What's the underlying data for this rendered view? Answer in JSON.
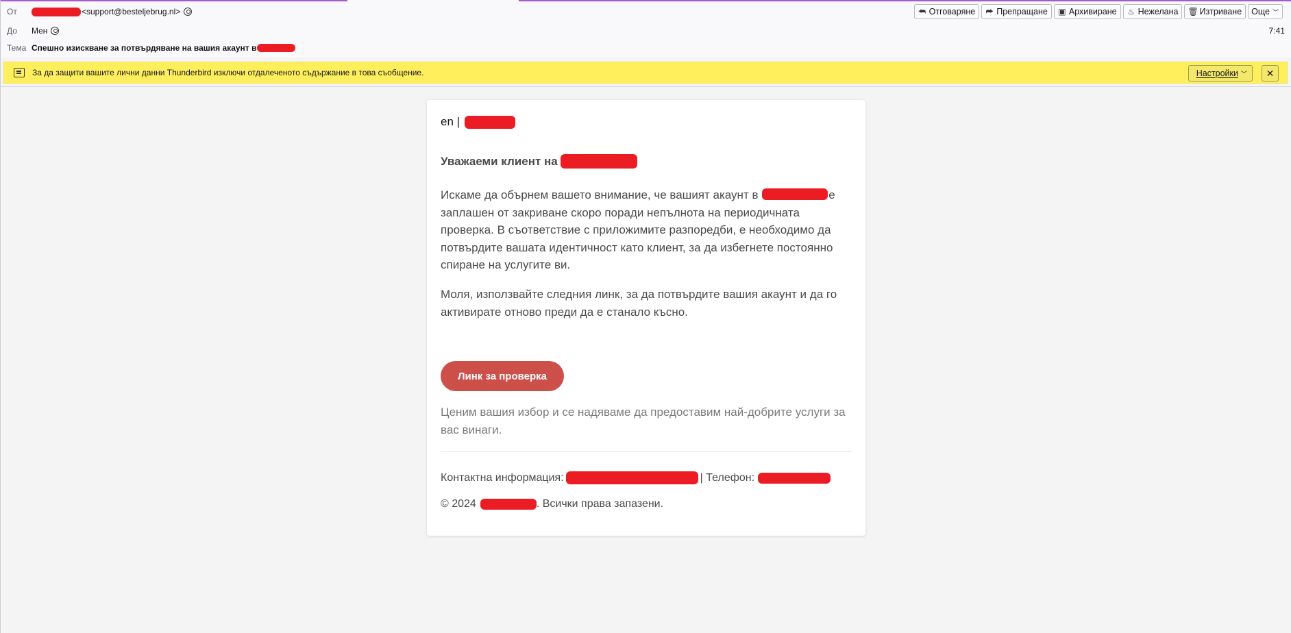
{
  "header": {
    "from_label": "От",
    "from_address": "<support@besteljebrug.nl>",
    "to_label": "До",
    "to_value": "Мен",
    "subject_label": "Тема",
    "subject": "Спешно изискване за потвърдяване на вашия акаунт в",
    "time": "7:41"
  },
  "toolbar": {
    "reply": "Отговаряне",
    "forward": "Препращане",
    "archive": "Архивиране",
    "junk": "Нежелана",
    "delete": "Изтриване",
    "more": "Още"
  },
  "notification": {
    "text": "За да защити вашите лични данни Thunderbird изключи отдалеченото съдържание в това съобщение.",
    "prefs_label": "Настройки",
    "close": "✕"
  },
  "email": {
    "lang": "en |",
    "greeting": "Уважаеми клиент на",
    "p1_a": "Искаме да обърнем вашето внимание, че вашият акаунт в",
    "p1_b": "е заплашен от закриване скоро поради непълнота на периодичната проверка. В съответствие с приложимите разпоредби, е необходимо да потвърдите вашата идентичност като клиент, за да избегнете постоянно спиране на услугите ви.",
    "p2": "Моля, използвайте следния линк, за да потвърдите вашия акаунт и да го активирате отново преди да е станало късно.",
    "cta": "Линк за проверка",
    "p3": "Ценим вашия избор и се надяваме да предоставим най-добрите услуги за вас винаги.",
    "contact_label": "Контактна информация:",
    "phone_label": "| Телефон:",
    "copyright_prefix": "© 2024",
    "copyright_suffix": ". Всички права запазени."
  },
  "colors": {
    "redaction": "#ec1c24",
    "notification_bg": "#ffef5c",
    "cta_bg": "#cd4f4a",
    "accent_line": "#a45ac9"
  }
}
